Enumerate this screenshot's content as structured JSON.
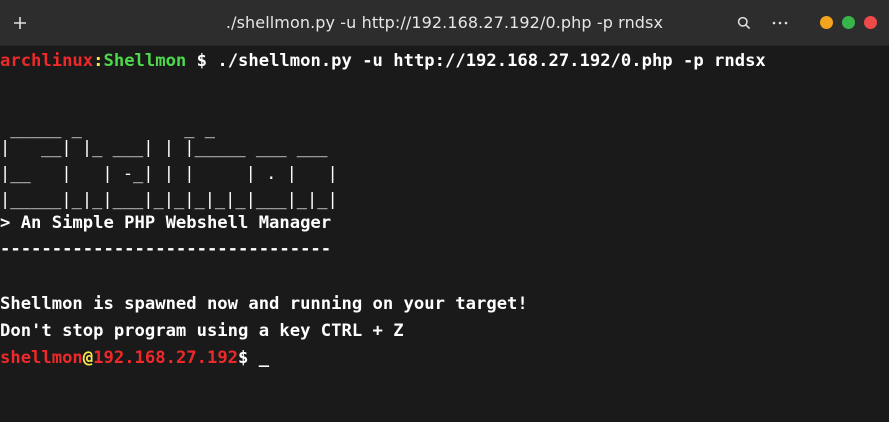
{
  "titlebar": {
    "title": "./shellmon.py -u http://192.168.27.192/0.php -p rndsx",
    "colors": {
      "minimize": "#f3a51d",
      "maximize": "#37b44a",
      "close": "#ef4a4a"
    }
  },
  "terminal": {
    "prompt": {
      "host": "archlinux",
      "separator": ":",
      "dir": "Shellmon",
      "symbol": " $ ",
      "command": "./shellmon.py -u http://192.168.27.192/0.php -p rndsx"
    },
    "banner": {
      "tagline": "> An Simple PHP Webshell Manager",
      "rule": "--------------------------------"
    },
    "messages": [
      "Shellmon is spawned now and running on your target!",
      "Don't stop program using a key CTRL + Z"
    ],
    "shell_prompt": {
      "user": "shellmon",
      "at": "@",
      "host": "192.168.27.192",
      "symbol": "$ ",
      "cursor": "_"
    },
    "colors": {
      "host": "#ef2929",
      "separator": "#fce94f",
      "dir": "#4cd94a",
      "text": "#ffffff",
      "background": "#1a1a1a"
    }
  }
}
